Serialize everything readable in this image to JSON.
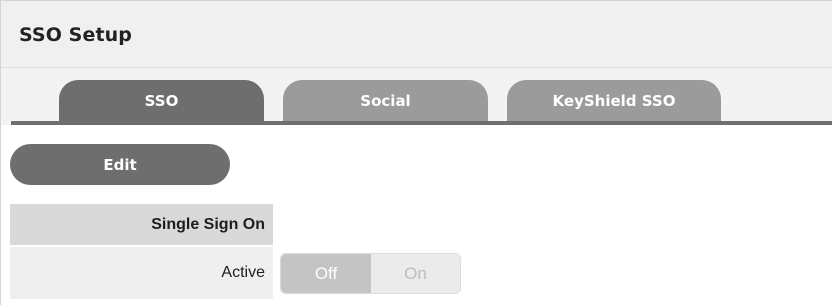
{
  "header": {
    "title": "SSO Setup"
  },
  "tabs": [
    {
      "label": "SSO",
      "active": true
    },
    {
      "label": "Social",
      "active": false
    },
    {
      "label": "KeyShield SSO",
      "active": false
    }
  ],
  "actions": {
    "edit_label": "Edit"
  },
  "section": {
    "title": "Single Sign On"
  },
  "fields": {
    "active": {
      "label": "Active",
      "options": [
        "Off",
        "On"
      ],
      "selected": "Off"
    }
  },
  "colors": {
    "tab_active": "#6e6e6e",
    "tab_inactive": "#9b9b9b",
    "button": "#6e6e6e",
    "toggle_selected": "#c4c4c4",
    "toggle_unselected": "#ebebeb"
  }
}
